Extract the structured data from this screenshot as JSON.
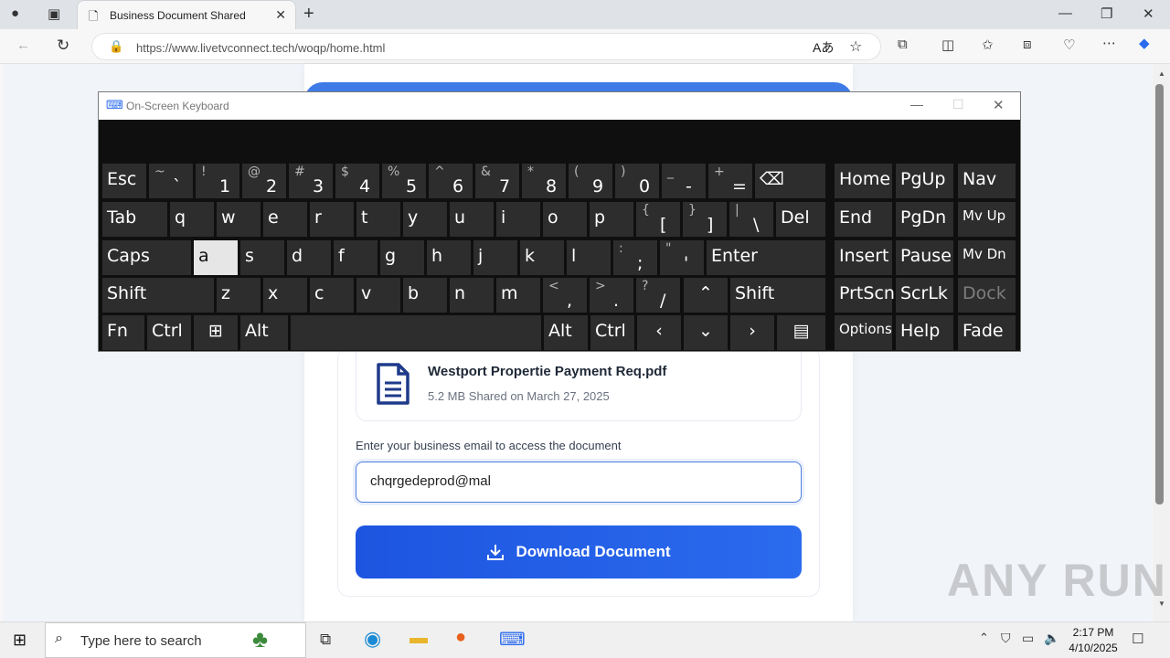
{
  "browser": {
    "tab_title": "Business Document Shared",
    "url": "https://www.livetvconnect.tech/woqp/home.html"
  },
  "document": {
    "file_name": "Westport Propertie Payment Req.pdf",
    "file_meta": "5.2 MB Shared on March 27, 2025",
    "email_label": "Enter your business email to access the document",
    "email_value": "chqrgedeprod@mal",
    "download_label": "Download Document"
  },
  "osk": {
    "title": "On-Screen Keyboard",
    "keys": {
      "esc": "Esc",
      "tab": "Tab",
      "caps": "Caps",
      "shift": "Shift",
      "fn": "Fn",
      "ctrl": "Ctrl",
      "alt": "Alt",
      "del": "Del",
      "enter": "Enter",
      "shift_r": "Shift",
      "alt_r": "Alt",
      "ctrl_r": "Ctrl",
      "home": "Home",
      "pgup": "PgUp",
      "nav": "Nav",
      "end": "End",
      "pgdn": "PgDn",
      "mvup": "Mv Up",
      "insert": "Insert",
      "pause": "Pause",
      "mvdn": "Mv Dn",
      "prtscn": "PrtScn",
      "scrlk": "ScrLk",
      "dock": "Dock",
      "options": "Options",
      "help": "Help",
      "fade": "Fade"
    },
    "num_row": [
      [
        "~",
        "`"
      ],
      [
        "!",
        "1"
      ],
      [
        "@",
        "2"
      ],
      [
        "#",
        "3"
      ],
      [
        "$",
        "4"
      ],
      [
        "%",
        "5"
      ],
      [
        "^",
        "6"
      ],
      [
        "&",
        "7"
      ],
      [
        "*",
        "8"
      ],
      [
        "(",
        "9"
      ],
      [
        ")",
        "0"
      ],
      [
        "_",
        "-"
      ],
      [
        "+",
        "="
      ]
    ],
    "row_q": [
      "q",
      "w",
      "e",
      "r",
      "t",
      "y",
      "u",
      "i",
      "o",
      "p"
    ],
    "row_q_sym": [
      [
        "{",
        "["
      ],
      [
        "}",
        "]"
      ],
      [
        "|",
        "\\"
      ]
    ],
    "row_a": [
      "a",
      "s",
      "d",
      "f",
      "g",
      "h",
      "j",
      "k",
      "l"
    ],
    "row_a_sym": [
      [
        ":",
        ";"
      ],
      [
        "\"",
        "'"
      ]
    ],
    "row_z": [
      "z",
      "x",
      "c",
      "v",
      "b",
      "n",
      "m"
    ],
    "row_z_sym": [
      [
        "<",
        ","
      ],
      [
        ">",
        "."
      ],
      [
        "?",
        "/"
      ]
    ]
  },
  "taskbar": {
    "search_placeholder": "Type here to search",
    "time": "2:17 PM",
    "date": "4/10/2025"
  },
  "watermark": "ANY RUN"
}
